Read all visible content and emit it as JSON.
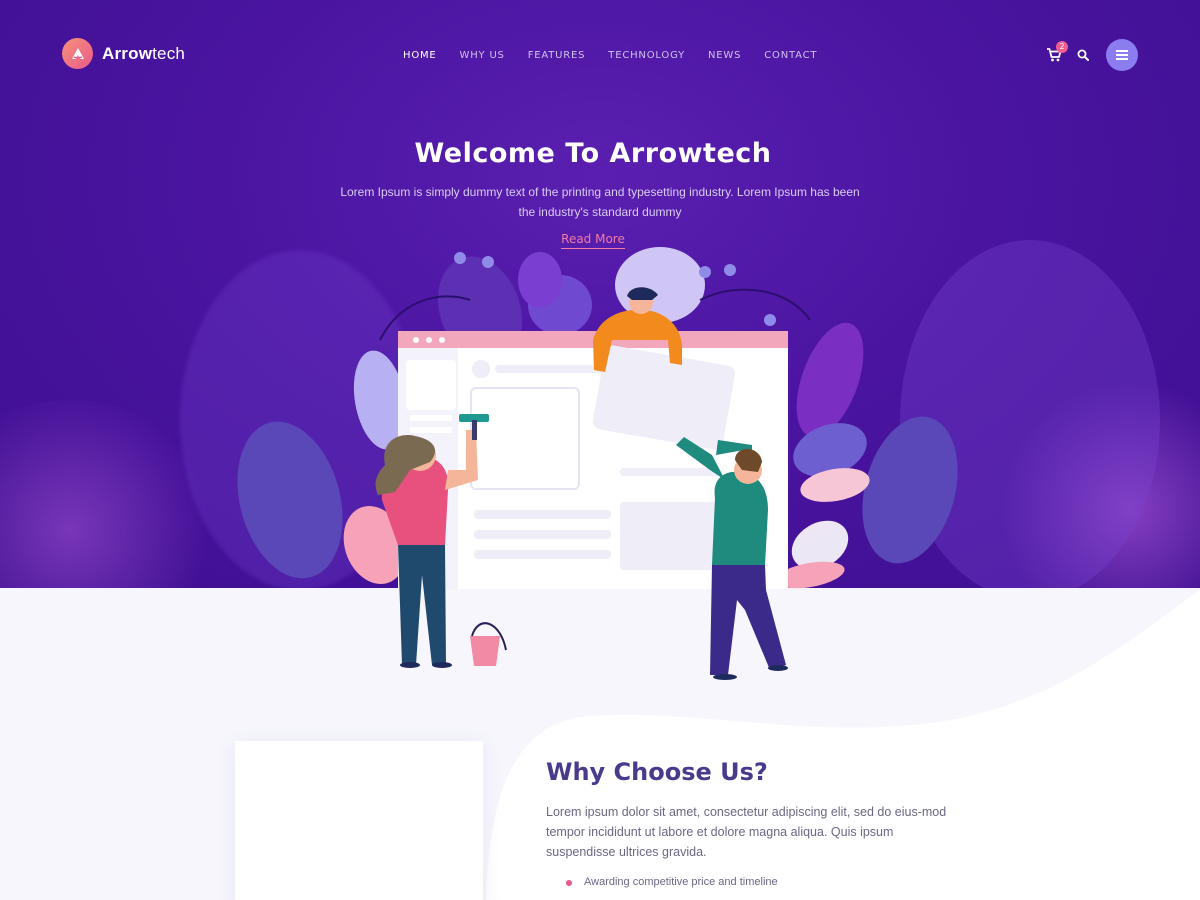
{
  "brand": {
    "name_bold": "Arrow",
    "name_rest": "tech"
  },
  "nav": {
    "items": [
      "HOME",
      "WHY US",
      "FEATURES",
      "TECHNOLOGY",
      "NEWS",
      "CONTACT"
    ],
    "active_index": 0
  },
  "header_actions": {
    "cart_count": "2",
    "cart_icon": "cart-icon",
    "search_icon": "search-icon",
    "menu_icon": "hamburger-icon"
  },
  "hero": {
    "title": "Welcome To Arrowtech",
    "subtitle": "Lorem Ipsum is simply dummy text of the printing and typesetting industry. Lorem Ipsum has been the industry's standard dummy",
    "cta": "Read More"
  },
  "why": {
    "title": "Why Choose Us?",
    "text": "Lorem ipsum dolor sit amet, consectetur adipiscing elit, sed do eius-mod tempor incididunt ut labore et dolore magna aliqua. Quis ipsum suspendisse ultrices gravida.",
    "points": [
      "Awarding competitive price and timeline"
    ]
  },
  "colors": {
    "hero_bg": "#4a14a0",
    "accent_pink": "#f27aa3",
    "heading": "#4a3a8c",
    "menu_button": "#8b7cf0"
  }
}
